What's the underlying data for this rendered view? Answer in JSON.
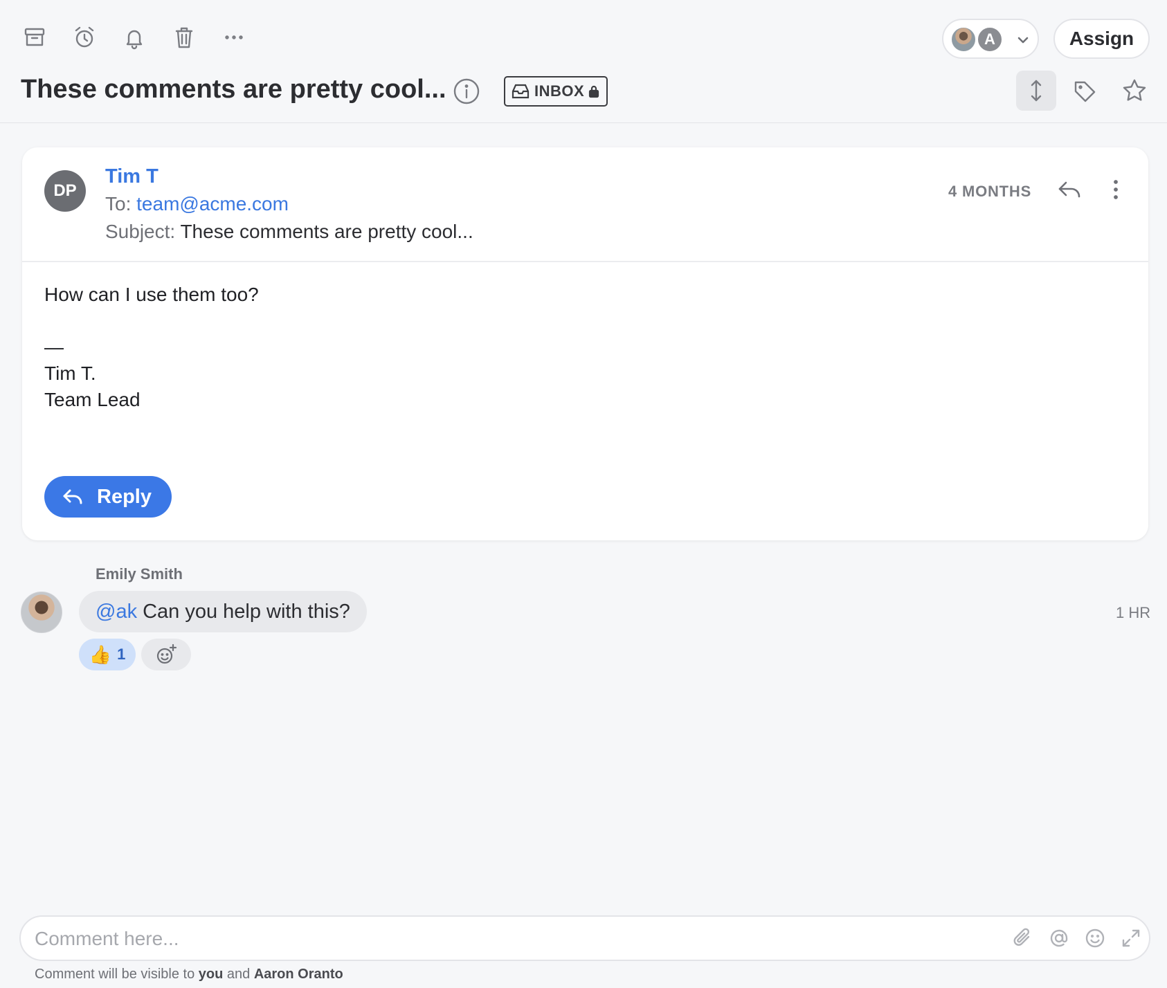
{
  "toolbar": {
    "icons": [
      "archive-icon",
      "snooze-clock-icon",
      "bell-icon",
      "trash-icon",
      "more-horizontal-icon"
    ],
    "assignee_initial": "A",
    "assign_label": "Assign"
  },
  "conversation": {
    "title": "These comments are pretty cool...",
    "inbox_tag": "INBOX"
  },
  "email": {
    "avatar_initials": "DP",
    "sender": "Tim T",
    "to_label": "To:",
    "to_address": "team@acme.com",
    "subject_label": "Subject:",
    "subject": "These comments are pretty cool...",
    "time_ago": "4 MONTHS",
    "body": "How can I use them too?\n\n—\nTim T.\nTeam Lead",
    "reply_label": "Reply"
  },
  "comment": {
    "author": "Emily Smith",
    "mention": "@ak",
    "text": "Can you help with this?",
    "time": "1 HR",
    "reaction_emoji": "👍",
    "reaction_count": "1"
  },
  "composer": {
    "placeholder": "Comment here...",
    "visibility_prefix": "Comment will be visible to",
    "visibility_you": "you",
    "visibility_and": "and",
    "visibility_other": "Aaron Oranto"
  },
  "colors": {
    "accent": "#3b78e6",
    "link": "#3a78e0",
    "background": "#f6f7f9"
  }
}
